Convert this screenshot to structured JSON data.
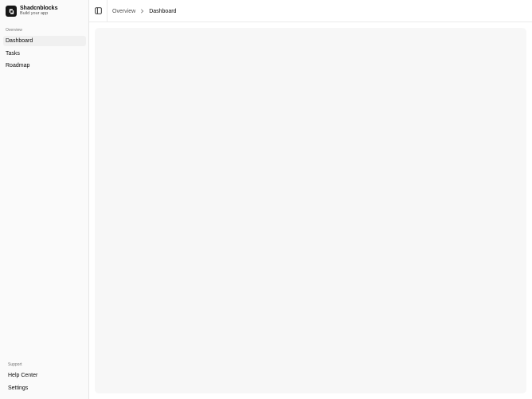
{
  "brand": {
    "name": "Shadcnblocks",
    "subtitle": "Build your app",
    "logo_icon": "logo-icon"
  },
  "sidebar": {
    "overview_label": "Overview",
    "items": [
      {
        "label": "Dashboard",
        "active": true
      },
      {
        "label": "Tasks",
        "active": false
      },
      {
        "label": "Roadmap",
        "active": false
      }
    ],
    "support_label": "Support",
    "support_items": [
      {
        "label": "Help Center"
      },
      {
        "label": "Settings"
      }
    ]
  },
  "header": {
    "toggle_icon": "sidebar-toggle-icon",
    "breadcrumb": {
      "parent": "Overview",
      "current": "Dashboard",
      "separator_icon": "chevron-right-icon"
    }
  },
  "colors": {
    "sidebar_bg": "#fafafa",
    "active_item_bg": "#f0f0f0",
    "content_panel_bg": "#f7f7f7",
    "logo_bg": "#171717"
  }
}
